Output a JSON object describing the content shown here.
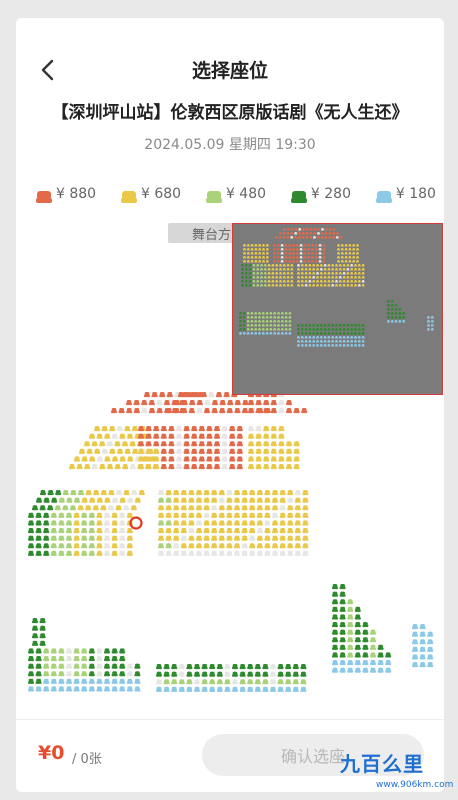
{
  "header": {
    "title": "选择座位",
    "back_icon": "chevron-left-icon"
  },
  "show": {
    "title": "【深圳坪山站】伦敦西区原版话剧《无人生还》",
    "datetime": "2024.05.09 星期四 19:30"
  },
  "price_legend": [
    {
      "label": "¥ 880",
      "color": "#e26a4a"
    },
    {
      "label": "¥ 680",
      "color": "#e9c84a"
    },
    {
      "label": "¥ 480",
      "color": "#a9d27a"
    },
    {
      "label": "¥ 280",
      "color": "#2f8a2f"
    },
    {
      "label": "¥ 180",
      "color": "#8cc8e8"
    }
  ],
  "stage": {
    "label": "舞台方向"
  },
  "seat_colors": {
    "sold": "#e6e6e6",
    "selected_ring": "#e03a22",
    "minimap_frame": "#d43a3a"
  },
  "footer": {
    "total_price": "¥0",
    "ticket_count": "/ 0张",
    "confirm_label": "确认选座"
  },
  "watermark": {
    "text": "九百么里",
    "sub": "www.906km.com"
  }
}
